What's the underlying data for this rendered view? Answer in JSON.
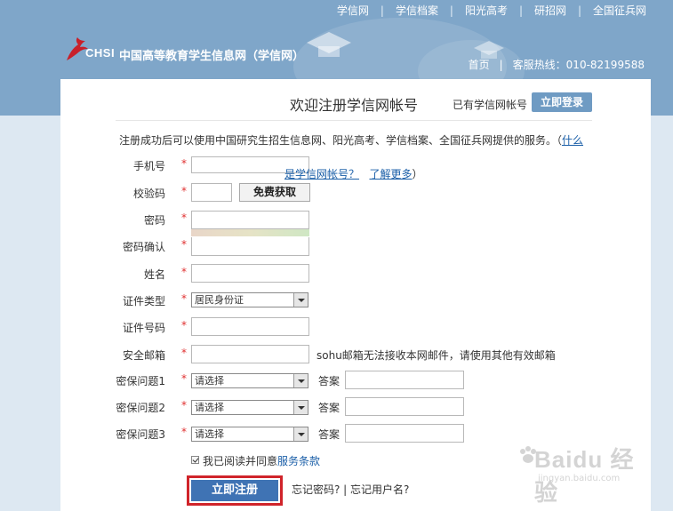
{
  "top_nav": [
    "学信网",
    "学信档案",
    "阳光高考",
    "研招网",
    "全国征兵网"
  ],
  "logo": {
    "mark": "CHSI",
    "name": "中国高等教育学生信息网（学信网）"
  },
  "sub_nav": {
    "home": "首页",
    "hotline": "客服热线：010-82199588"
  },
  "panel": {
    "title": "欢迎注册学信网帐号",
    "have_account": "已有学信网帐号",
    "login_button": "立即登录",
    "intro": "注册成功后可以使用中国研究生招生信息网、阳光高考、学信档案、全国征兵网提供的服务。（",
    "intro_link": "什么",
    "intro_link2": "是学信网帐号？",
    "intro_link3": "了解更多",
    "intro_end": "）"
  },
  "form": {
    "phone_label": "手机号",
    "code_label": "校验码",
    "get_code_button": "免费获取",
    "password_label": "密码",
    "confirm_label": "密码确认",
    "name_label": "姓名",
    "id_type_label": "证件类型",
    "id_type_value": "居民身份证",
    "id_number_label": "证件号码",
    "email_label": "安全邮箱",
    "email_hint": "sohu邮箱无法接收本网邮件，请使用其他有效邮箱",
    "q1_label": "密保问题1",
    "q2_label": "密保问题2",
    "q3_label": "密保问题3",
    "question_placeholder": "请选择",
    "answer_label": "答案",
    "required_mark": "*",
    "agree_text": "我已阅读并同意",
    "agree_link": "服务条款",
    "register_button": "立即注册",
    "forgot": "忘记密码? | 忘记用户名?"
  },
  "watermark": {
    "main": "Baidu 经验",
    "sub": "jingyan.baidu.com"
  }
}
